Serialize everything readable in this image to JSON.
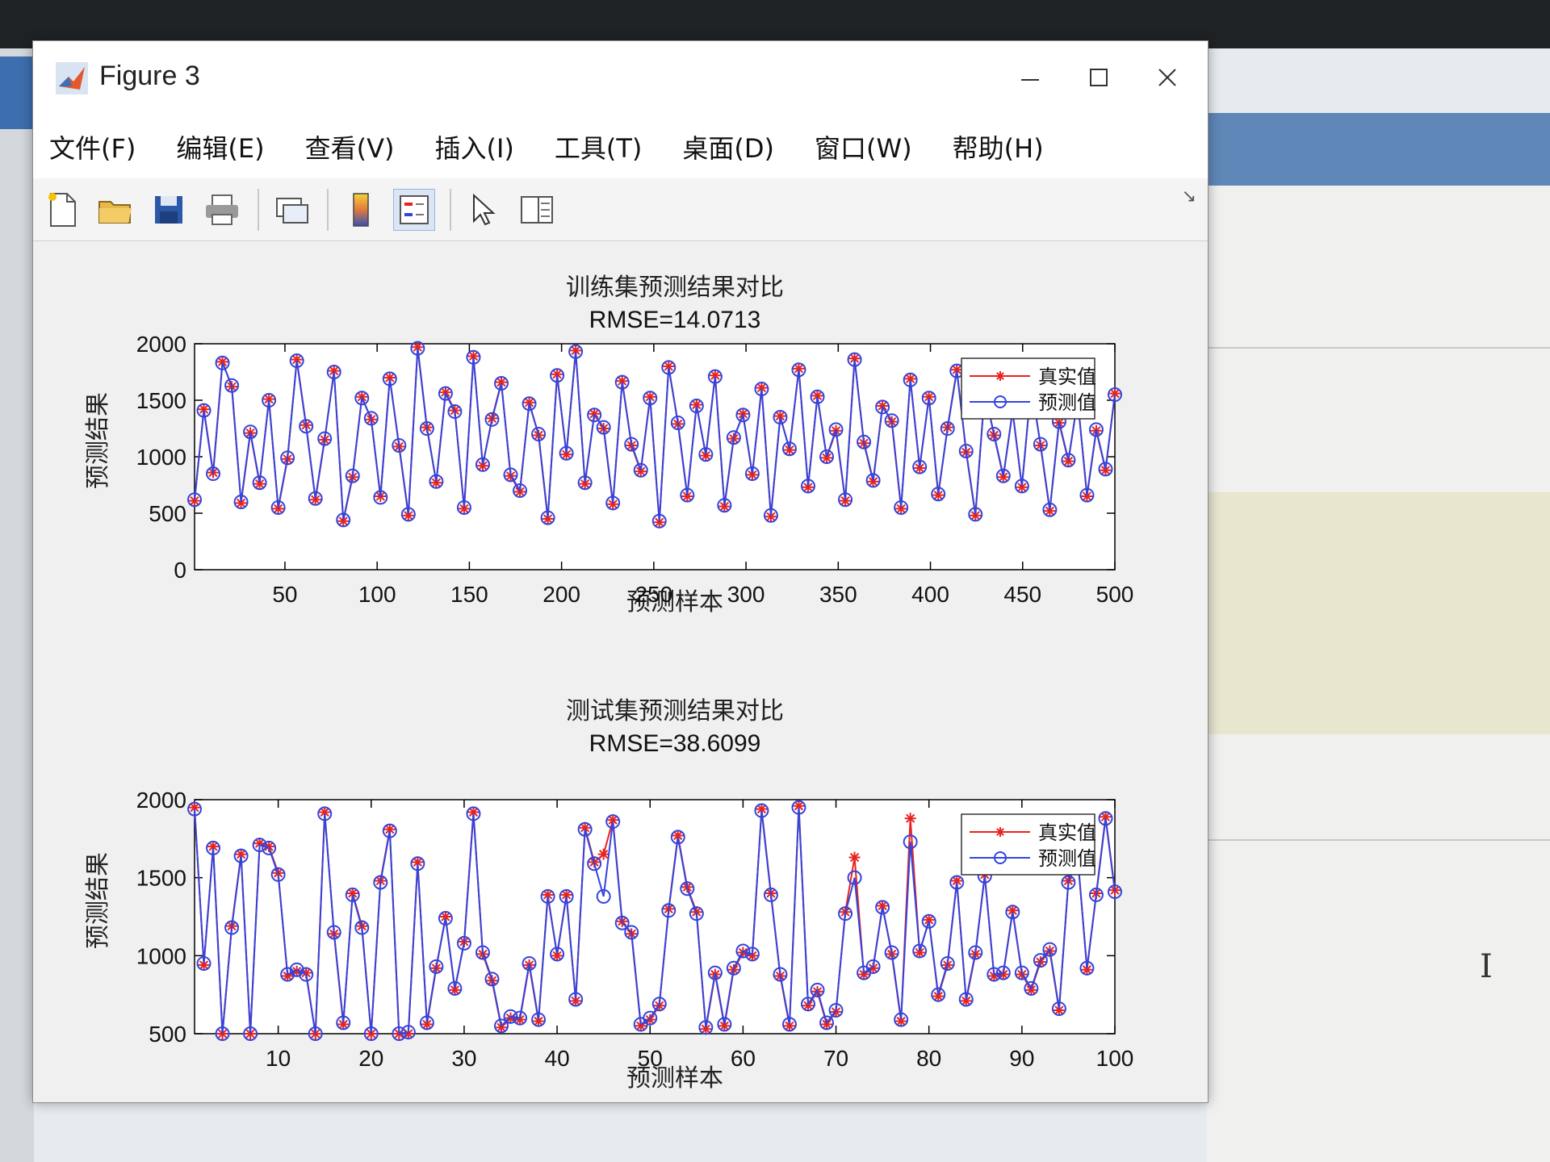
{
  "window": {
    "title": "Figure 3",
    "buttons": [
      "minimize",
      "maximize",
      "close"
    ]
  },
  "menu": [
    "文件(F)",
    "编辑(E)",
    "查看(V)",
    "插入(I)",
    "工具(T)",
    "桌面(D)",
    "窗口(W)",
    "帮助(H)"
  ],
  "toolbar": {
    "icons": [
      "new-file-icon",
      "open-folder-icon",
      "save-icon",
      "print-icon",
      "link-plot-icon",
      "colorbar-icon",
      "legend-icon",
      "pointer-icon",
      "property-editor-icon"
    ]
  },
  "colors": {
    "true_series": "#e8231f",
    "pred_series": "#3344dd",
    "axes": "#000000"
  },
  "chart_data": [
    {
      "type": "line",
      "title": "训练集预测结果对比",
      "subtitle": "RMSE=14.0713",
      "xlabel": "预测样本",
      "ylabel": "预测结果",
      "xlim": [
        1,
        500
      ],
      "ylim": [
        0,
        2000
      ],
      "xticks": [
        50,
        100,
        150,
        200,
        250,
        300,
        350,
        400,
        450,
        500
      ],
      "yticks": [
        0,
        500,
        1000,
        1500,
        2000
      ],
      "legend": "top-right",
      "series": [
        {
          "name": "真实值",
          "marker": "*",
          "color": "#e8231f",
          "values": [
            610,
            1420,
            860,
            1840,
            1620,
            590,
            1210,
            760,
            1510,
            540,
            980,
            1860,
            1280,
            620,
            1150,
            1760,
            430,
            820,
            1530,
            1330,
            650,
            1700,
            1090,
            480,
            1970,
            1260,
            770,
            1570,
            1410,
            540,
            1890,
            920,
            1340,
            1660,
            830,
            690,
            1480,
            1190,
            450,
            1730,
            1020,
            1940,
            760,
            1380,
            1250,
            580,
            1670,
            1100,
            870,
            1530,
            420,
            1800,
            1290,
            650,
            1460,
            1010,
            1720,
            560,
            1160,
            1380,
            840,
            1610,
            470,
            1360,
            1060,
            1780,
            730,
            1540,
            990,
            1230,
            610,
            1870,
            1120,
            780,
            1450,
            1310,
            540,
            1690,
            900,
            1530,
            660,
            1260,
            1770,
            1040,
            480,
            1580,
            1190,
            820,
            1410,
            730,
            1640,
            1100,
            520,
            1300,
            960,
            1510,
            650,
            1230,
            880,
            1560
          ],
          "note_x": "plotted across samples 1-500"
        },
        {
          "name": "预测值",
          "marker": "o",
          "color": "#3344dd",
          "values": [
            620,
            1410,
            850,
            1830,
            1630,
            600,
            1220,
            770,
            1500,
            550,
            990,
            1850,
            1270,
            630,
            1160,
            1750,
            440,
            830,
            1520,
            1340,
            640,
            1690,
            1100,
            490,
            1960,
            1250,
            780,
            1560,
            1400,
            550,
            1880,
            930,
            1330,
            1650,
            840,
            700,
            1470,
            1200,
            460,
            1720,
            1030,
            1930,
            770,
            1370,
            1260,
            590,
            1660,
            1110,
            880,
            1520,
            430,
            1790,
            1300,
            660,
            1450,
            1020,
            1710,
            570,
            1170,
            1370,
            850,
            1600,
            480,
            1350,
            1070,
            1770,
            740,
            1530,
            1000,
            1240,
            620,
            1860,
            1130,
            790,
            1440,
            1320,
            550,
            1680,
            910,
            1520,
            670,
            1250,
            1760,
            1050,
            490,
            1570,
            1200,
            830,
            1400,
            740,
            1630,
            1110,
            530,
            1310,
            970,
            1500,
            660,
            1240,
            890,
            1550
          ]
        }
      ]
    },
    {
      "type": "line",
      "title": "测试集预测结果对比",
      "subtitle": "RMSE=38.6099",
      "xlabel": "预测样本",
      "ylabel": "预测结果",
      "xlim": [
        1,
        100
      ],
      "ylim": [
        500,
        2000
      ],
      "xticks": [
        10,
        20,
        30,
        40,
        50,
        60,
        70,
        80,
        90,
        100
      ],
      "yticks": [
        500,
        1000,
        1500,
        2000
      ],
      "legend": "top-right",
      "series": [
        {
          "name": "真实值",
          "marker": "*",
          "color": "#e8231f",
          "values": [
            1950,
            940,
            1700,
            450,
            1190,
            1650,
            450,
            1720,
            1700,
            1530,
            870,
            900,
            890,
            470,
            1920,
            1140,
            560,
            1400,
            1190,
            490,
            1480,
            1810,
            480,
            500,
            1600,
            560,
            920,
            1250,
            780,
            1090,
            1920,
            1010,
            840,
            540,
            600,
            590,
            940,
            580,
            1390,
            1000,
            1390,
            710,
            1820,
            1600,
            1650,
            1870,
            1220,
            1140,
            550,
            590,
            680,
            1300,
            1770,
            1440,
            1280,
            530,
            880,
            550,
            910,
            1020,
            1000,
            1940,
            1400,
            870,
            550,
            1960,
            680,
            770,
            560,
            640,
            1280,
            1630,
            880,
            920,
            1320,
            1010,
            580,
            1880,
            1020,
            1230,
            740,
            940,
            1480,
            710,
            1010,
            1520,
            870,
            880,
            1290,
            880,
            780,
            960,
            1030,
            650,
            1480,
            1640,
            910,
            1400,
            1890,
            1420
          ]
        },
        {
          "name": "预测值",
          "marker": "o",
          "color": "#3344dd",
          "values": [
            1940,
            950,
            1690,
            460,
            1180,
            1640,
            460,
            1710,
            1690,
            1520,
            880,
            910,
            880,
            480,
            1910,
            1150,
            570,
            1390,
            1180,
            500,
            1470,
            1800,
            490,
            510,
            1590,
            570,
            930,
            1240,
            790,
            1080,
            1910,
            1020,
            850,
            550,
            610,
            600,
            950,
            590,
            1380,
            1010,
            1380,
            720,
            1810,
            1590,
            1380,
            1860,
            1210,
            1150,
            560,
            600,
            690,
            1290,
            1760,
            1430,
            1270,
            540,
            890,
            560,
            920,
            1030,
            1010,
            1930,
            1390,
            880,
            560,
            1950,
            690,
            780,
            570,
            650,
            1270,
            1500,
            890,
            930,
            1310,
            1020,
            590,
            1730,
            1030,
            1220,
            750,
            950,
            1470,
            720,
            1020,
            1510,
            880,
            890,
            1280,
            890,
            790,
            970,
            1040,
            660,
            1470,
            1630,
            920,
            1390,
            1880,
            1410
          ]
        }
      ]
    }
  ]
}
